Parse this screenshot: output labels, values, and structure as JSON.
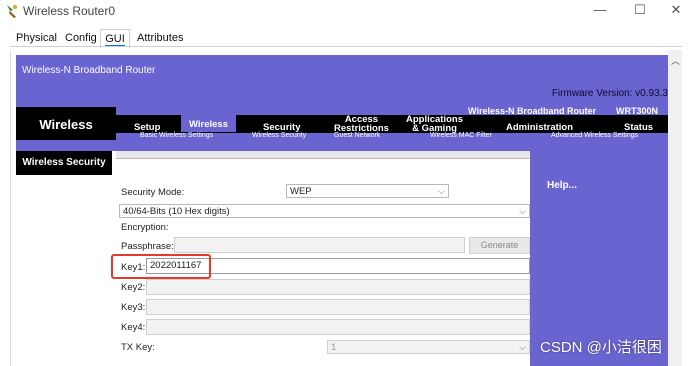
{
  "window": {
    "title": "Wireless Router0",
    "controls": {
      "minimize": "—",
      "maximize": "☐",
      "close": "✕"
    }
  },
  "tabs": [
    {
      "label": "Physical"
    },
    {
      "label": "Config"
    },
    {
      "label": "GUI",
      "active": true
    },
    {
      "label": "Attributes"
    }
  ],
  "router": {
    "product_name": "Wireless-N Broadband Router",
    "firmware": "Firmware Version: v0.93.3",
    "model_name": "Wireless-N Broadband Router",
    "model_number": "WRT300N",
    "section_title": "Wireless",
    "nav": {
      "setup": "Setup",
      "wireless": "Wireless",
      "security": "Security",
      "access_1": "Access",
      "access_2": "Restrictions",
      "apps_1": "Applications",
      "apps_2": "& Gaming",
      "administration": "Administration",
      "status": "Status"
    },
    "subnav": {
      "basic": "Basic Wireless Settings",
      "security": "Wireless Security",
      "guest": "Guest Network",
      "mac": "Wireless MAC Filter",
      "advanced": "Advanced Wireless Settings"
    },
    "side_label": "Wireless Security"
  },
  "form": {
    "security_mode_label": "Security Mode:",
    "security_mode_value": "WEP",
    "encryption_select_value": "40/64-Bits (10 Hex digits)",
    "encryption_label": "Encryption:",
    "passphrase_label": "Passphrase:",
    "passphrase_value": "",
    "generate_label": "Generate",
    "key1_label": "Key1:",
    "key1_value": "2022011167",
    "key2_label": "Key2:",
    "key3_label": "Key3:",
    "key4_label": "Key4:",
    "txkey_label": "TX Key:",
    "txkey_value": "1"
  },
  "help": {
    "label": "Help..."
  },
  "watermark": "CSDN @小洁很困",
  "colors": {
    "purple": "#6a64d1",
    "black": "#000000",
    "highlight": "#e23b2e"
  }
}
